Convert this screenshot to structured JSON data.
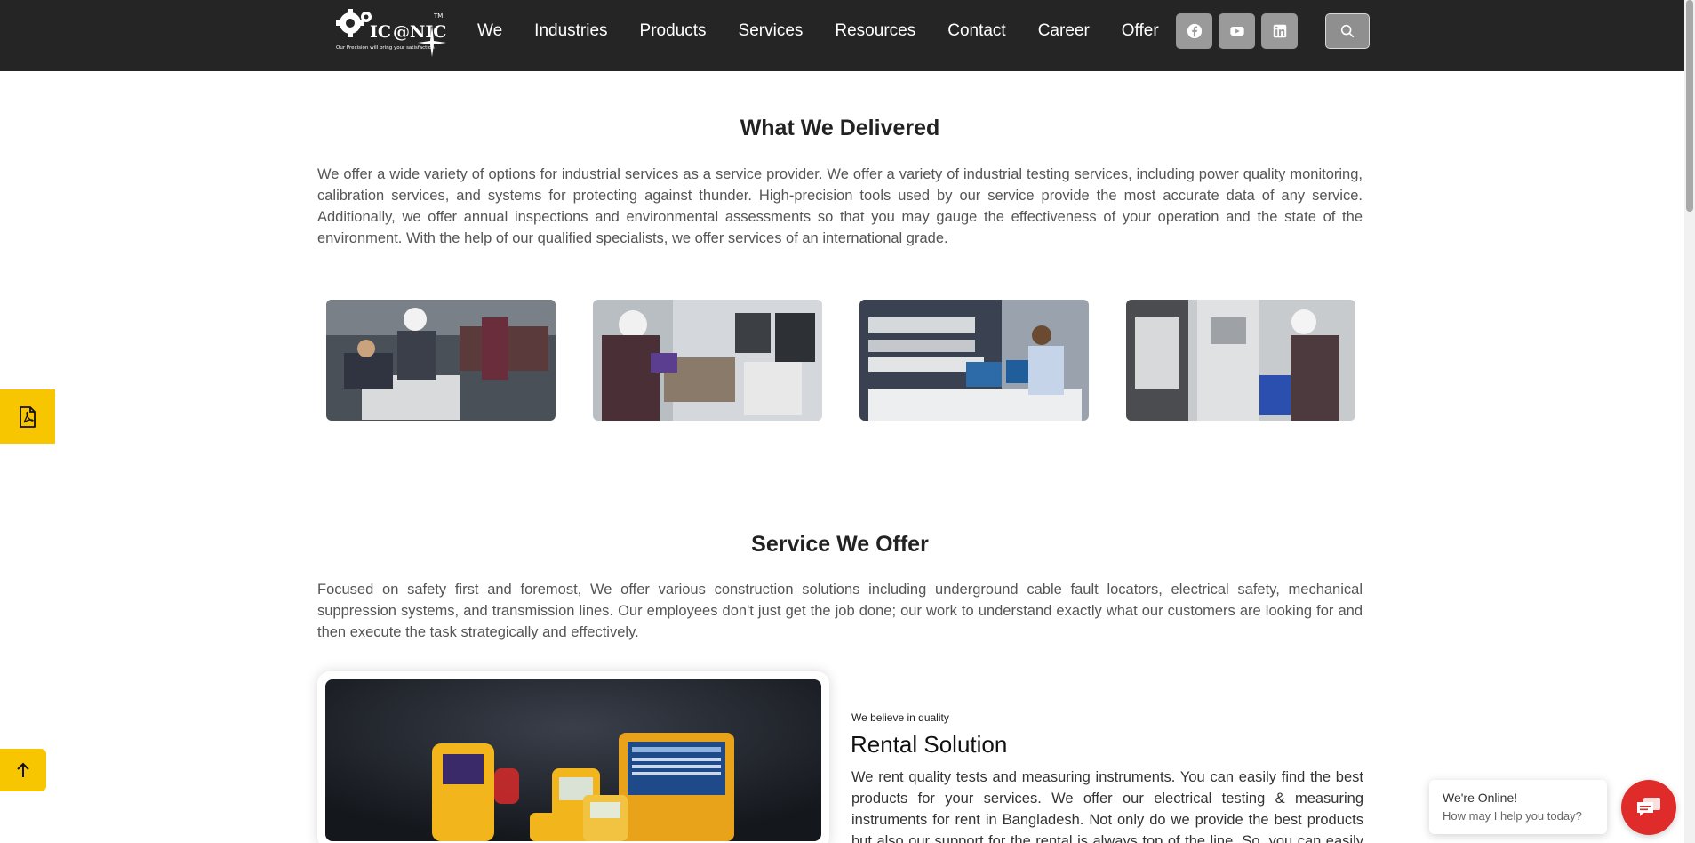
{
  "brand": {
    "logo_text": "ICONIC",
    "tagline": "Our Precision will bring your satisfaction",
    "trademark": "TM"
  },
  "nav": {
    "items": [
      {
        "label": "We"
      },
      {
        "label": "Industries"
      },
      {
        "label": "Products"
      },
      {
        "label": "Services"
      },
      {
        "label": "Resources"
      },
      {
        "label": "Contact"
      },
      {
        "label": "Career"
      },
      {
        "label": "Offer"
      }
    ]
  },
  "social": {
    "icons": [
      "facebook-icon",
      "youtube-icon",
      "linkedin-icon"
    ],
    "search_icon": "search-icon"
  },
  "colors": {
    "header_bg": "#252525",
    "accent_yellow": "#f7c600",
    "chat_red": "#e02b2b"
  },
  "delivered": {
    "title": "What We Delivered",
    "body": "We offer a wide variety of options for industrial services as a service provider. We offer a variety of industrial testing services, including power quality monitoring, calibration services, and systems for protecting against thunder. High-precision tools used by our service provide the most accurate data of any service. Additionally, we offer annual inspections and environmental assessments so that you may gauge the effectiveness of your operation and the state of the environment. With the help of our qualified specialists, we offer services of an international grade."
  },
  "service": {
    "title": "Service We Offer",
    "body": "Focused on safety first and foremost, We offer various construction solutions including underground cable fault locators, electrical safety, mechanical suppression systems, and transmission lines. Our employees don't just get the job done; our work to understand exactly what our customers are looking for and then execute the task strategically and effectively."
  },
  "rental": {
    "kicker": "We believe in quality",
    "title": "Rental Solution",
    "body": "We rent quality tests and measuring instruments. You can easily find the best products for your services. We offer our electrical testing & measuring instruments for rent in Bangladesh. Not only do we provide the best products but also our support for the rental is always top of the line. So, you can easily trust us"
  },
  "chat": {
    "status": "We're Online!",
    "prompt": "How may I help you today?"
  }
}
